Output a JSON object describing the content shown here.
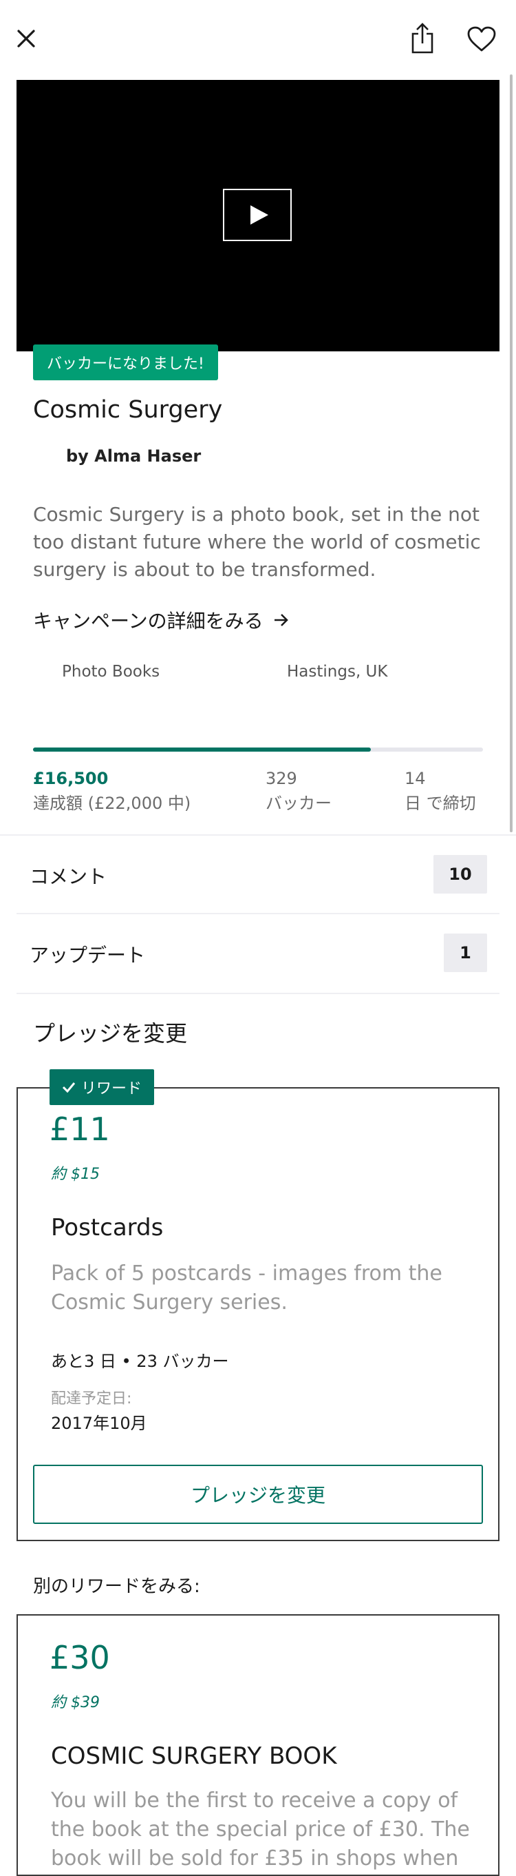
{
  "header": {
    "close_icon": "close-icon",
    "share_icon": "share-icon",
    "heart_icon": "heart-icon"
  },
  "video": {
    "play_icon": "play-icon"
  },
  "project": {
    "backer_badge": "バッカーになりました!",
    "title": "Cosmic Surgery",
    "creator": "by Alma Haser",
    "blurb": "Cosmic Surgery is a photo book, set in the not too distant future where the world of cosmetic surgery is about to be transformed.",
    "details_link": "キャンペーンの詳細をみる",
    "category": "Photo Books",
    "location": "Hastings, UK"
  },
  "stats": {
    "progress_fraction": 0.75,
    "pledged": "£16,500",
    "pledged_label": "達成額 (£22,000 中)",
    "backers": "329",
    "backers_label": "バッカー",
    "days": "14",
    "days_label": "日 で締切"
  },
  "rows": {
    "comments_label": "コメント",
    "comments_count": "10",
    "updates_label": "アップデート",
    "updates_count": "1"
  },
  "pledge": {
    "section_title": "プレッジを変更",
    "reward_badge": "リワード",
    "price": "£11",
    "approx": "約 $15",
    "title": "Postcards",
    "description": "Pack of 5 postcards - images from the Cosmic Surgery series.",
    "remaining": "あと3 日 • 23 バッカー",
    "delivery_label": "配達予定日:",
    "delivery_date": "2017年10月",
    "change_button": "プレッジを変更"
  },
  "other_rewards": {
    "title": "別のリワードをみる:",
    "price": "£30",
    "approx": "約 $39",
    "name": "COSMIC SURGERY BOOK",
    "description": "You will be the first to receive a copy of the book at the special price of £30. The book will be sold for £35 in shops when"
  },
  "colors": {
    "accent": "#037362",
    "badge_green": "#029e74"
  }
}
